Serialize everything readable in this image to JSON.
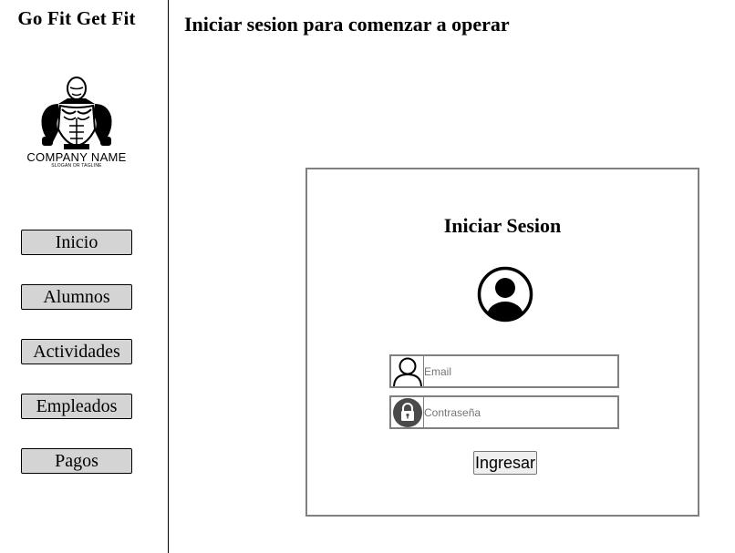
{
  "sidebar": {
    "brand": "Go Fit Get Fit",
    "logo": {
      "icon": "bodybuilder-logo",
      "company_name": "COMPANY NAME",
      "slogan": "SLOGAN OR TAGLINE"
    },
    "nav": [
      {
        "label": "Inicio"
      },
      {
        "label": "Alumnos"
      },
      {
        "label": "Actividades"
      },
      {
        "label": "Empleados"
      },
      {
        "label": "Pagos"
      }
    ]
  },
  "main": {
    "heading": "Iniciar sesion para comenzar a operar"
  },
  "login": {
    "title": "Iniciar Sesion",
    "avatar_icon": "user-circle-icon",
    "email": {
      "icon": "user-outline-icon",
      "placeholder": "Email",
      "value": ""
    },
    "password": {
      "icon": "lock-icon",
      "placeholder": "Contraseña",
      "value": ""
    },
    "submit_label": "Ingresar"
  },
  "colors": {
    "nav_button_bg": "#d4d4d4",
    "card_border": "#808080",
    "lock_icon_bg": "#4a4a4a"
  }
}
